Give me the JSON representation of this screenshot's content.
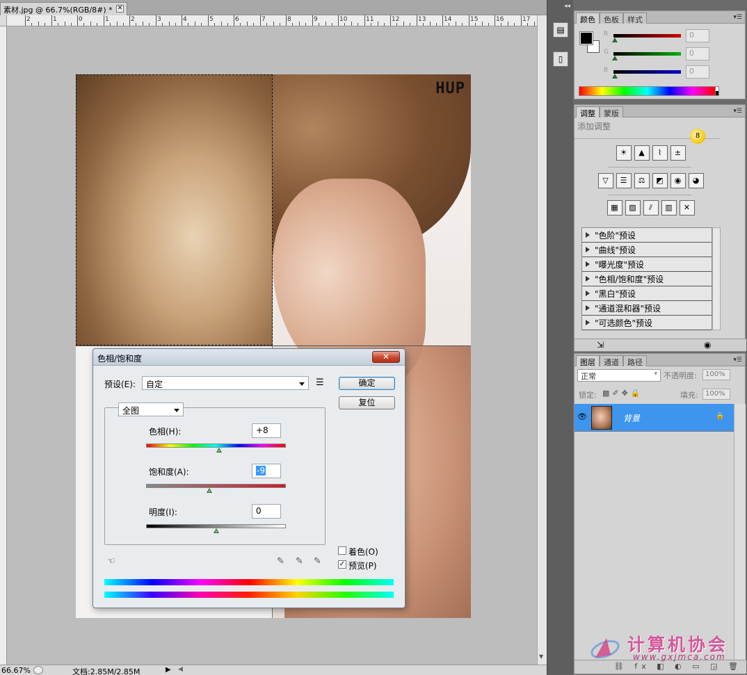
{
  "document": {
    "tab_title": "素材.jpg @ 66.7%(RGB/8#) *",
    "close_glyph": "✕",
    "ruler_labels": [
      "2",
      "1",
      "0",
      "1",
      "2",
      "3",
      "4",
      "5",
      "6",
      "7",
      "8",
      "9",
      "10",
      "11",
      "12",
      "13",
      "14",
      "15",
      "16",
      "17"
    ],
    "image_logo": "HUP"
  },
  "dialog": {
    "title": "色相/饱和度",
    "close_glyph": "✕",
    "preset_label": "预设(E):",
    "preset_value": "自定",
    "channel_value": "全图",
    "ok_label": "确定",
    "reset_label": "复位",
    "hue": {
      "label": "色相(H):",
      "value": "+8",
      "level": 8,
      "min": -180,
      "max": 180
    },
    "saturation": {
      "label": "饱和度(A):",
      "value": "-9",
      "level": -9,
      "min": -100,
      "max": 100
    },
    "lightness": {
      "label": "明度(I):",
      "value": "0",
      "level": 0,
      "min": -100,
      "max": 100
    },
    "colorize_label": "着色(O)",
    "colorize_checked": false,
    "preview_label": "预览(P)",
    "preview_checked": true,
    "preview_check_glyph": "✓",
    "menu_glyph": "☰",
    "hand_glyph": "☜",
    "dropper_glyphs": [
      "✎",
      "✎",
      "✎"
    ]
  },
  "statusbar": {
    "zoom": "66.67%",
    "doc_info": "文档:2.85M/2.85M",
    "arrow": "▶",
    "left_arrow": "◀"
  },
  "color_panel": {
    "tabs": [
      "颜色",
      "色板",
      "样式"
    ],
    "rows": [
      {
        "letter": "R",
        "value": "0",
        "color": "#cc0000"
      },
      {
        "letter": "G",
        "value": "0",
        "color": "#00b000"
      },
      {
        "letter": "B",
        "value": "0",
        "color": "#0000cc"
      }
    ]
  },
  "adjust_panel": {
    "tabs": [
      "调整",
      "蒙版"
    ],
    "heading": "添加调整",
    "bulb_count": "8",
    "row1_icons": [
      "☀",
      "▲",
      "⌇",
      "±"
    ],
    "row2_icons": [
      "▽",
      "☰",
      "⚖",
      "◩",
      "◉",
      "◕"
    ],
    "row3_icons": [
      "▦",
      "▨",
      "⫽",
      "▥",
      "✕"
    ],
    "presets": [
      "\"色阶\"预设",
      "\"曲线\"预设",
      "\"曝光度\"预设",
      "\"色相/饱和度\"预设",
      "\"黑白\"预设",
      "\"通道混和器\"预设",
      "\"可选颜色\"预设"
    ],
    "footer_left_icon": "⇲",
    "footer_right_icon": "◉"
  },
  "layers_panel": {
    "tabs": [
      "图层",
      "通道",
      "路径"
    ],
    "blend_mode": "正常",
    "opacity_label": "不透明度:",
    "opacity_value": "100%",
    "lock_label": "锁定:",
    "lock_icons": [
      "▩",
      "✐",
      "✥",
      "🔒"
    ],
    "fill_label": "填充:",
    "fill_value": "100%",
    "layer_name": "背景",
    "eye_glyph": "👁",
    "lock_glyph": "🔒",
    "footer_icons": "⛓ fx ◧ ◐ ▭ ◲ 🗑"
  },
  "dock": {
    "icons": [
      "▤",
      "▯"
    ],
    "collapse_glyph": "◂◂"
  },
  "watermark": {
    "text": "计算机协会",
    "url": "www.gxjmca.com"
  }
}
